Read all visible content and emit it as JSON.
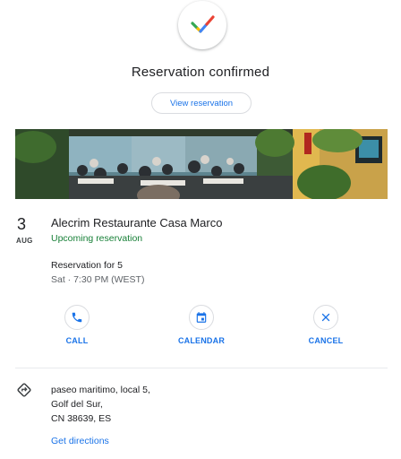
{
  "header": {
    "title": "Reservation confirmed",
    "view_button": "View reservation",
    "check_colors": [
      "#34a853",
      "#fbbc04",
      "#ea4335",
      "#4285f4"
    ]
  },
  "reservation": {
    "day": "3",
    "month": "AUG",
    "restaurant_name": "Alecrim Restaurante Casa Marco",
    "status": "Upcoming reservation",
    "party": "Reservation for 5",
    "time": "Sat · 7:30 PM (WEST)"
  },
  "actions": [
    {
      "label": "CALL",
      "icon": "phone-icon"
    },
    {
      "label": "CALENDAR",
      "icon": "calendar-icon"
    },
    {
      "label": "CANCEL",
      "icon": "close-icon"
    }
  ],
  "address": {
    "line1": "paseo maritimo, local 5,",
    "line2": "Golf del Sur,",
    "line3": "CN 38639, ES",
    "directions_link": "Get directions",
    "icon": "directions-icon"
  },
  "colors": {
    "accent": "#1a73e8",
    "status_green": "#188038"
  }
}
